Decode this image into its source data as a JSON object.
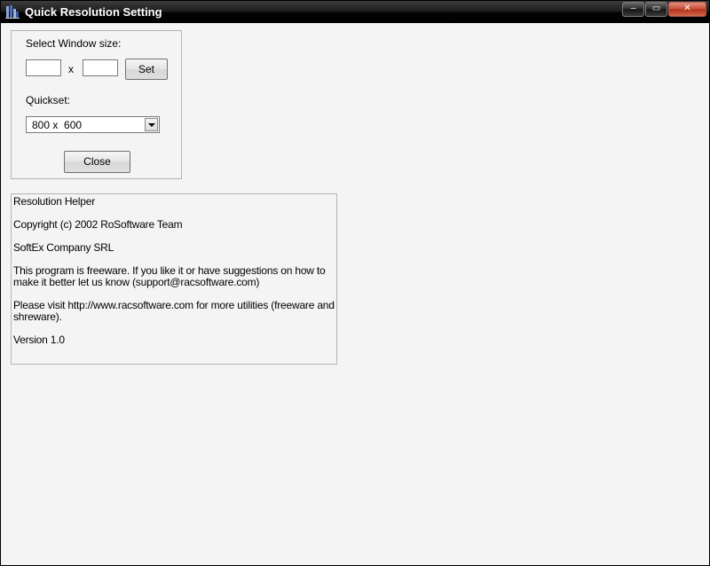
{
  "window": {
    "title": "Quick Resolution Setting",
    "caption_buttons": {
      "minimize": "‒",
      "maximize": "▭",
      "close": "✕"
    }
  },
  "settings": {
    "window_size_label": "Select Window size:",
    "width_value": "",
    "height_value": "",
    "times_label": "x",
    "set_label": "Set",
    "quickset_label": "Quickset:",
    "quickset_selected": "800 x  600",
    "close_label": "Close"
  },
  "info": {
    "lines": [
      "Resolution Helper",
      "Copyright (c) 2002 RoSoftware Team",
      "SoftEx Company SRL",
      "This program is freeware. If you like it or have suggestions on how to make it better let us know (support@racsoftware.com)",
      "Please visit http://www.racsoftware.com for more utilities (freeware and shreware).",
      "Version 1.0"
    ]
  },
  "colors": {
    "titlebar": "#000000",
    "close_button": "#c84a33",
    "client_background": "#f4f4f4"
  },
  "icons": {
    "app": "app-icon",
    "dropdown": "chevron-down-icon"
  }
}
